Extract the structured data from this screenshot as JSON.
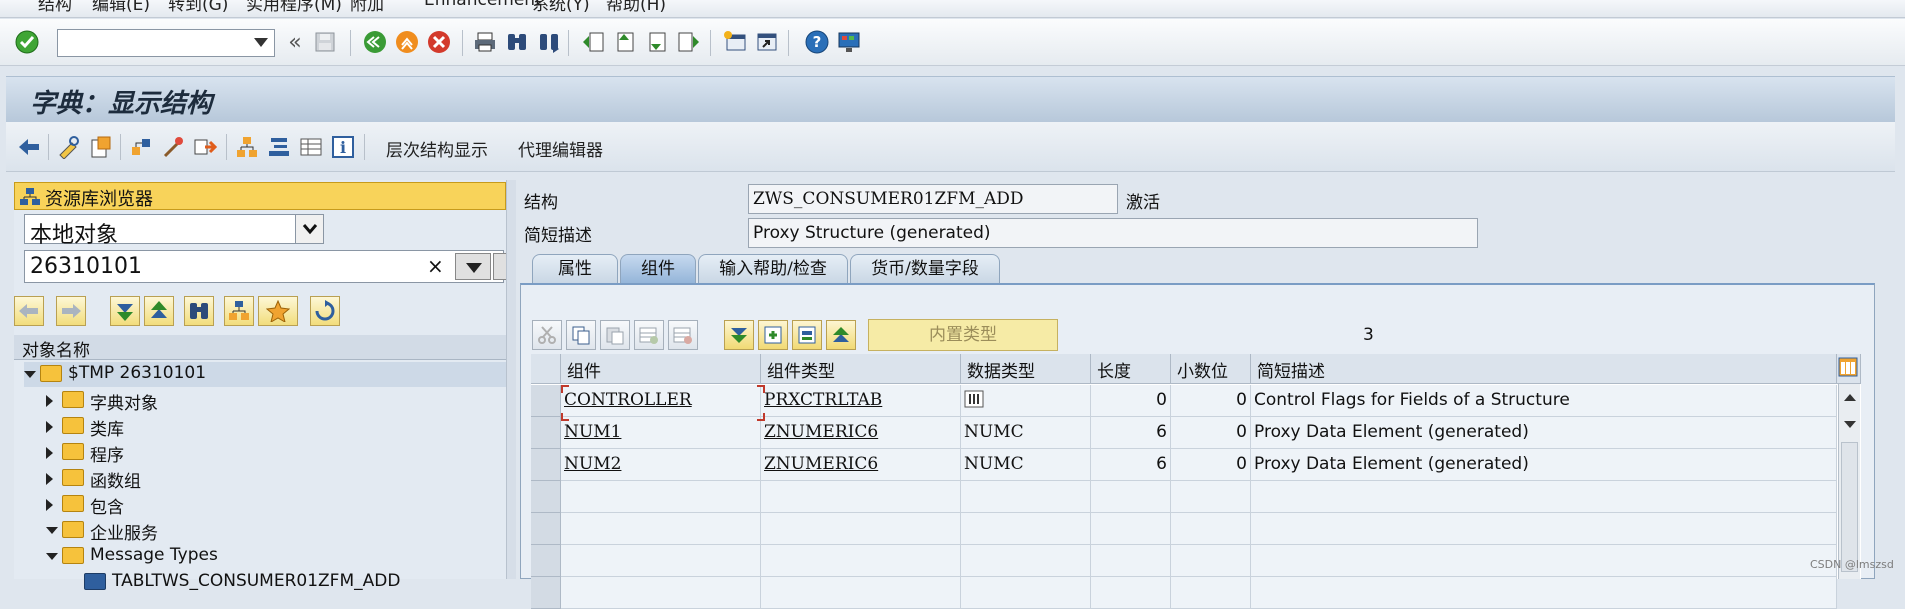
{
  "menu": [
    "结构",
    "编辑(E)",
    "转到(G)",
    "实用程序(M)",
    "附加",
    "Enhancement",
    "系统(Y)",
    "帮助(H)"
  ],
  "system_toolbar": {
    "command_field_value": "",
    "icons": [
      "enter-check-icon",
      "back-arrows-icon",
      "save-icon",
      "back-icon",
      "exit-icon",
      "cancel-icon",
      "print-icon",
      "find-icon",
      "find-next-icon",
      "first-page-icon",
      "prev-page-icon",
      "next-page-icon",
      "last-page-icon",
      "new-session-icon",
      "shortcut-icon",
      "help-icon",
      "customize-layout-icon"
    ]
  },
  "title": "字典：显示结构",
  "app_toolbar": {
    "hierarchy_label": "层次结构显示",
    "proxy_editor_label": "代理编辑器"
  },
  "left": {
    "repo_browser_label": "资源库浏览器",
    "object_type": "本地对象",
    "object_name": "26310101",
    "clear_symbol": "×",
    "tree_header": "对象名称",
    "tree": [
      {
        "label": "$TMP 26310101",
        "level": 0,
        "expanded": true
      },
      {
        "label": "字典对象",
        "level": 1,
        "expanded": false
      },
      {
        "label": "类库",
        "level": 1,
        "expanded": false
      },
      {
        "label": "程序",
        "level": 1,
        "expanded": false
      },
      {
        "label": "函数组",
        "level": 1,
        "expanded": false
      },
      {
        "label": "包含",
        "level": 1,
        "expanded": false
      },
      {
        "label": "企业服务",
        "level": 1,
        "expanded": true
      },
      {
        "label": "Message Types",
        "level": 2,
        "expanded": true
      },
      {
        "label": "TABLTWS_CONSUMER01ZFM_ADD",
        "level": 3,
        "expanded": false
      }
    ]
  },
  "form": {
    "structure_label": "结构",
    "structure_value": "ZWS_CONSUMER01ZFM_ADD",
    "status": "激活",
    "short_desc_label": "简短描述",
    "short_desc_value": "Proxy Structure (generated)"
  },
  "tabs": [
    {
      "label": "属性",
      "active": false
    },
    {
      "label": "组件",
      "active": true
    },
    {
      "label": "输入帮助/检查",
      "active": false
    },
    {
      "label": "货币/数量字段",
      "active": false
    }
  ],
  "table_toolbar": {
    "builtin_type_label": "内置类型",
    "count": "3"
  },
  "table": {
    "columns": [
      "组件",
      "组件类型",
      "数据类型",
      "长度",
      "小数位",
      "简短描述"
    ],
    "rows": [
      {
        "component": "CONTROLLER",
        "type": "PRXCTRLTAB",
        "datatype": "",
        "length": "0",
        "decimals": "0",
        "desc": "Control Flags for Fields of a Structure"
      },
      {
        "component": "NUM1",
        "type": "ZNUMERIC6",
        "datatype": "NUMC",
        "length": "6",
        "decimals": "0",
        "desc": "Proxy Data Element (generated)"
      },
      {
        "component": "NUM2",
        "type": "ZNUMERIC6",
        "datatype": "NUMC",
        "length": "6",
        "decimals": "0",
        "desc": "Proxy Data Element (generated)"
      }
    ]
  },
  "watermark": "CSDN @lmszsd"
}
